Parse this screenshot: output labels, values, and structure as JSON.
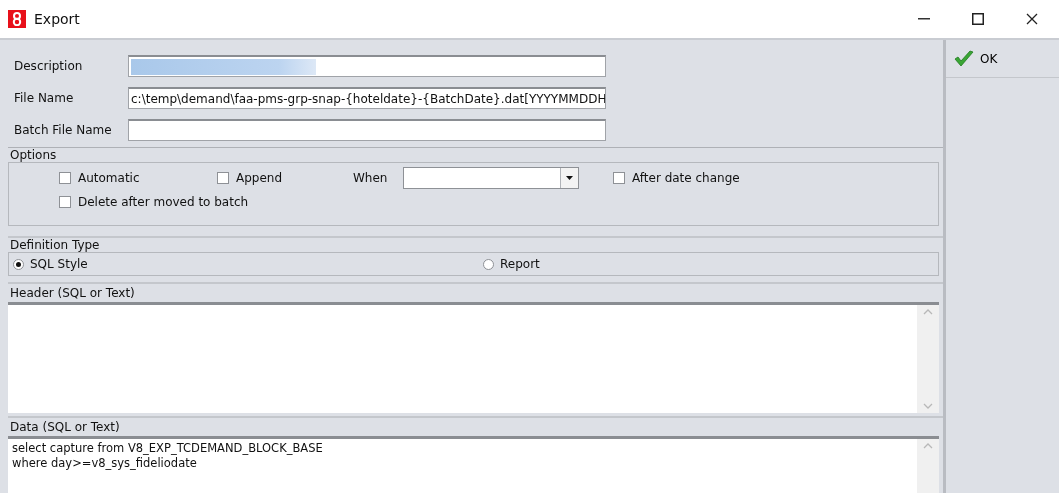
{
  "window": {
    "title": "Export"
  },
  "fields": [
    {
      "label": "Description",
      "selection": true
    },
    {
      "label": "File Name",
      "value": "c:\\temp\\demand\\faa-pms-grp-snap-{hoteldate}-{BatchDate}.dat[YYYYMMDDH"
    },
    {
      "label": "Batch File Name"
    }
  ],
  "options": {
    "title": "Options",
    "automatic": {
      "label": "Automatic",
      "checked": false
    },
    "append": {
      "label": "Append",
      "checked": false
    },
    "when": {
      "label": "When"
    },
    "after_date_change": {
      "label": "After date change",
      "checked": false
    },
    "delete_after_moved": {
      "label": "Delete after moved to batch",
      "checked": false
    }
  },
  "definition_type": {
    "title": "Definition Type",
    "choices": [
      {
        "label": "SQL Style",
        "selected": true
      },
      {
        "label": "Report",
        "selected": false
      }
    ]
  },
  "header": {
    "title": "Header (SQL or Text)"
  },
  "data": {
    "title": "Data (SQL or Text)",
    "text": "select capture from V8_EXP_TCDEMAND_BLOCK_BASE\nwhere day>=v8_sys_fideliodate"
  },
  "buttons": [
    {
      "label": "OK"
    }
  ]
}
